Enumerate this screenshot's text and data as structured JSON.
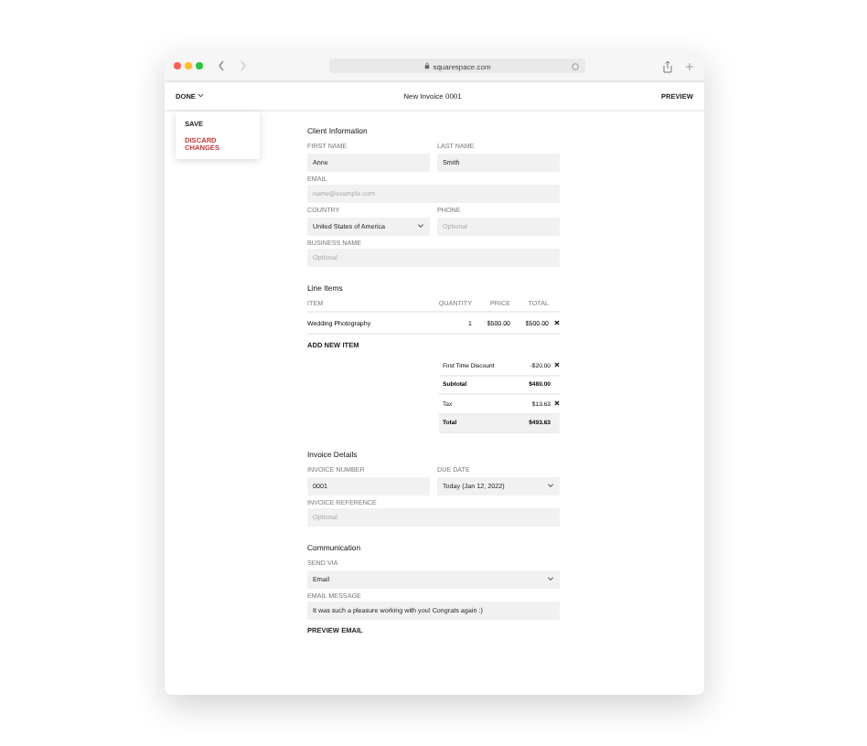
{
  "browser": {
    "url": "squarespace.com"
  },
  "header": {
    "menu": "DONE",
    "title": "New Invoice 0001",
    "action": "PREVIEW"
  },
  "menu": [
    {
      "label": "SAVE",
      "kind": "normal"
    },
    {
      "label": "DISCARD CHANGES",
      "kind": "danger"
    }
  ],
  "client": {
    "title": "Client Information",
    "rows": [
      [
        {
          "label": "FIRST NAME",
          "value": "Anne",
          "kind": "text"
        },
        {
          "label": "LAST NAME",
          "value": "Smith",
          "kind": "text"
        }
      ],
      [
        {
          "label": "EMAIL",
          "placeholder": "name@example.com",
          "kind": "text"
        }
      ],
      [
        {
          "label": "COUNTRY",
          "value": "United States of America",
          "kind": "select"
        },
        {
          "label": "PHONE",
          "placeholder": "Optional",
          "kind": "text"
        }
      ],
      [
        {
          "label": "BUSINESS NAME",
          "placeholder": "Optional",
          "kind": "text"
        }
      ]
    ]
  },
  "line_items": {
    "title": "Line Items",
    "columns": [
      "ITEM",
      "QUANTITY",
      "PRICE",
      "TOTAL"
    ],
    "rows": [
      {
        "item": "Wedding Photography",
        "quantity": "1",
        "price": "$500.00",
        "total": "$500.00"
      }
    ],
    "add": "ADD NEW ITEM",
    "summary": [
      {
        "label": "First Time Discount",
        "value": "-$20.00",
        "kind": "removable"
      },
      {
        "label": "Subtotal",
        "value": "$480.00",
        "kind": "plain"
      },
      {
        "label": "Tax",
        "value": "$13.63",
        "kind": "removable"
      },
      {
        "label": "Total",
        "value": "$493.63",
        "kind": "total"
      }
    ]
  },
  "invoice": {
    "title": "Invoice Details",
    "rows": [
      [
        {
          "label": "INVOICE NUMBER",
          "value": "0001",
          "kind": "text"
        },
        {
          "label": "DUE DATE",
          "value": "Today (Jan 12, 2022)",
          "kind": "select"
        }
      ],
      [
        {
          "label": "INVOICE REFERENCE",
          "placeholder": "Optional",
          "kind": "text"
        }
      ]
    ]
  },
  "communication": {
    "title": "Communication",
    "rows": [
      [
        {
          "label": "SEND VIA",
          "value": "Email",
          "kind": "select"
        }
      ],
      [
        {
          "label": "EMAIL MESSAGE",
          "value": "It was such a pleasure working with you! Congrats again :)",
          "kind": "text"
        }
      ]
    ],
    "link": "PREVIEW EMAIL"
  }
}
